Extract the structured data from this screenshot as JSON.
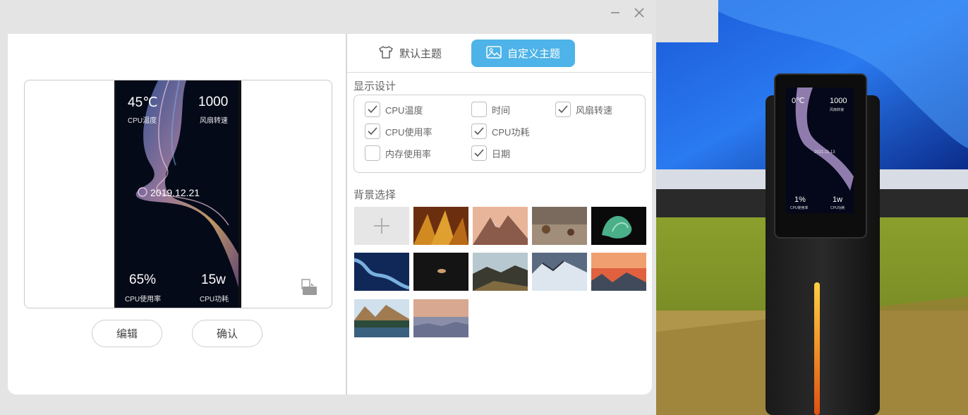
{
  "window": {
    "minimize_icon": "minimize-icon",
    "close_icon": "close-icon"
  },
  "preview": {
    "cpu_temp_value": "45℃",
    "cpu_temp_label": "CPU温度",
    "fan_speed_value": "1000",
    "fan_speed_label": "风扇转速",
    "date_value": "2019.12.21",
    "cpu_usage_value": "65%",
    "cpu_usage_label": "CPU使用率",
    "cpu_power_value": "15w",
    "cpu_power_label": "CPU功耗",
    "export_icon": "export-icon"
  },
  "buttons": {
    "edit": "编辑",
    "confirm": "确认"
  },
  "tabs": {
    "default": {
      "label": "默认主题",
      "icon": "tshirt-icon"
    },
    "custom": {
      "label": "自定义主题",
      "icon": "image-icon",
      "active": true
    }
  },
  "display_design": {
    "title": "显示设计",
    "options": [
      {
        "label": "CPU温度",
        "checked": true
      },
      {
        "label": "时间",
        "checked": false
      },
      {
        "label": "风扇转速",
        "checked": true
      },
      {
        "label": "CPU使用率",
        "checked": true
      },
      {
        "label": "CPU功耗",
        "checked": true
      },
      {
        "label": "内存使用率",
        "checked": false
      },
      {
        "label": "日期",
        "checked": true
      }
    ]
  },
  "background": {
    "title": "背景选择",
    "add_icon": "plus-icon",
    "thumbnails": [
      "autumn-leaves",
      "mountain-sunset",
      "desert-shrubs",
      "green-abstract",
      "blue-swirl",
      "dark-planet",
      "mountain-ridge",
      "snowy-peak",
      "pink-sky-mountains",
      "lake-reflection",
      "dusk-clouds"
    ]
  },
  "photo": {
    "device_cpu_temp": "0℃",
    "device_fan": "1000",
    "device_fan_label": "风扇转速",
    "device_cpu_usage": "1%",
    "device_cpu_usage_label": "CPU使用率",
    "device_power": "1w",
    "device_power_label": "CPU功耗",
    "device_date": "2021.11.13"
  }
}
